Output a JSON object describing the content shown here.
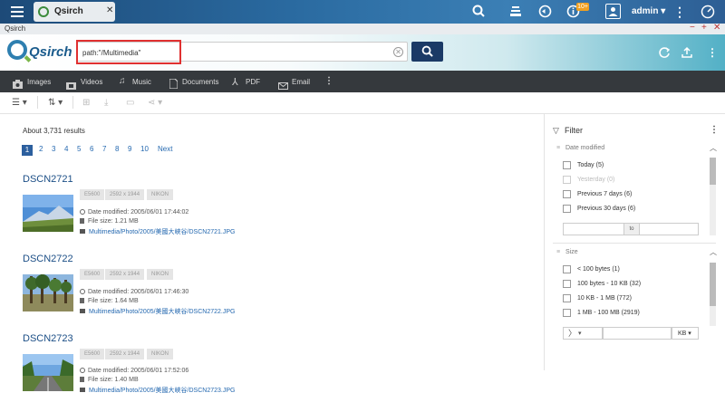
{
  "topbar": {
    "app_tab_label": "Qsirch",
    "notification_badge": "10+",
    "user_label": "admin"
  },
  "titlebar": {
    "title": "Qsirch"
  },
  "header": {
    "logo_text": "Qsirch",
    "search_value": "path:\"/Multimedia\""
  },
  "categories": [
    {
      "label": "Images",
      "icon": "camera-icon"
    },
    {
      "label": "Videos",
      "icon": "film-icon"
    },
    {
      "label": "Music",
      "icon": "music-note-icon"
    },
    {
      "label": "Documents",
      "icon": "document-icon"
    },
    {
      "label": "PDF",
      "icon": "pdf-icon"
    },
    {
      "label": "Email",
      "icon": "email-icon"
    }
  ],
  "results": {
    "count_text": "About 3,731 results",
    "pages": [
      "1",
      "2",
      "3",
      "4",
      "5",
      "6",
      "7",
      "8",
      "9",
      "10"
    ],
    "next_label": "Next",
    "items": [
      {
        "title": "DSCN2721",
        "tags": [
          "E5600",
          "2592 x 1944",
          "NIKON"
        ],
        "date_modified": "Date modified: 2005/06/01 17:44:02",
        "file_size": "File size: 1.21 MB",
        "path": "Multimedia/Photo/2005/美國大峽谷/DSCN2721.JPG"
      },
      {
        "title": "DSCN2722",
        "tags": [
          "E5600",
          "2592 x 1944",
          "NIKON"
        ],
        "date_modified": "Date modified: 2005/06/01 17:46:30",
        "file_size": "File size: 1.64 MB",
        "path": "Multimedia/Photo/2005/美國大峽谷/DSCN2722.JPG"
      },
      {
        "title": "DSCN2723",
        "tags": [
          "E5600",
          "2592 x 1944",
          "NIKON"
        ],
        "date_modified": "Date modified: 2005/06/01 17:52:06",
        "file_size": "File size: 1.40 MB",
        "path": "Multimedia/Photo/2005/美國大峽谷/DSCN2723.JPG"
      }
    ]
  },
  "filter": {
    "title": "Filter",
    "date_section": {
      "title": "Date modified",
      "options": [
        {
          "label": "Today (5)",
          "disabled": false
        },
        {
          "label": "Yesterday (0)",
          "disabled": true
        },
        {
          "label": "Previous 7 days (6)",
          "disabled": false
        },
        {
          "label": "Previous 30 days (6)",
          "disabled": false
        }
      ],
      "range_separator": "to"
    },
    "size_section": {
      "title": "Size",
      "options": [
        {
          "label": "< 100 bytes (1)"
        },
        {
          "label": "100 bytes - 10 KB (32)"
        },
        {
          "label": "10 KB - 1 MB (772)"
        },
        {
          "label": "1 MB - 100 MB (2919)"
        }
      ],
      "unit": "KB"
    }
  }
}
